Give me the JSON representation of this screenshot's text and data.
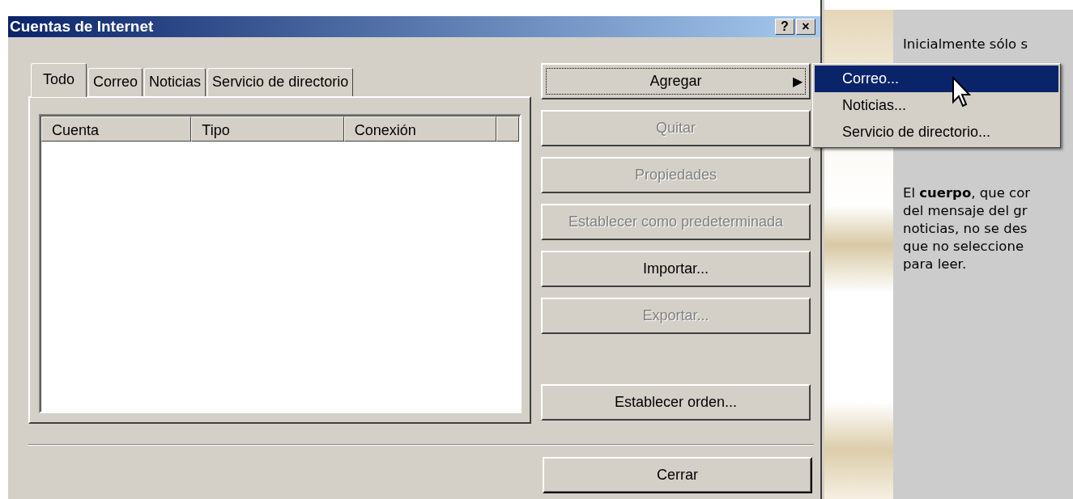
{
  "window": {
    "title": "Cuentas de Internet",
    "title_buttons": [
      "?",
      "×"
    ]
  },
  "tabs": [
    {
      "label": "Todo",
      "selected": true
    },
    {
      "label": "Correo",
      "selected": false
    },
    {
      "label": "Noticias",
      "selected": false
    },
    {
      "label": "Servicio de directorio",
      "selected": false
    }
  ],
  "accounts_list": {
    "columns": [
      "Cuenta",
      "Tipo",
      "Conexión"
    ]
  },
  "buttons": [
    {
      "label": "Agregar",
      "disabled": false,
      "focused": true,
      "kind": "submenu",
      "arrow": "▶"
    },
    {
      "label": "Quitar",
      "disabled": true,
      "focused": false,
      "kind": "push"
    },
    {
      "label": "Propiedades",
      "disabled": true,
      "focused": false,
      "kind": "push"
    },
    {
      "label": "Establecer como predeterminada",
      "disabled": true,
      "focused": false,
      "kind": "push"
    },
    {
      "label": "Importar...",
      "disabled": false,
      "focused": false,
      "kind": "push"
    },
    {
      "label": "Exportar...",
      "disabled": true,
      "focused": false,
      "kind": "push"
    },
    {
      "label": "Establecer orden...",
      "disabled": false,
      "focused": false,
      "kind": "gap"
    }
  ],
  "close_button": {
    "label": "Cerrar"
  },
  "submenu": {
    "items": [
      {
        "label": "Correo...",
        "selected": true
      },
      {
        "label": "Noticias...",
        "selected": false
      },
      {
        "label": "Servicio de directorio...",
        "selected": false
      }
    ]
  },
  "side_text": {
    "paragraphs": [
      [
        "Inicialmente sólo s"
      ],
      [
        "El **cuerpo**, que cor",
        "del mensaje del gr",
        "noticias, no se des",
        "que no seleccione",
        "para leer."
      ]
    ]
  }
}
